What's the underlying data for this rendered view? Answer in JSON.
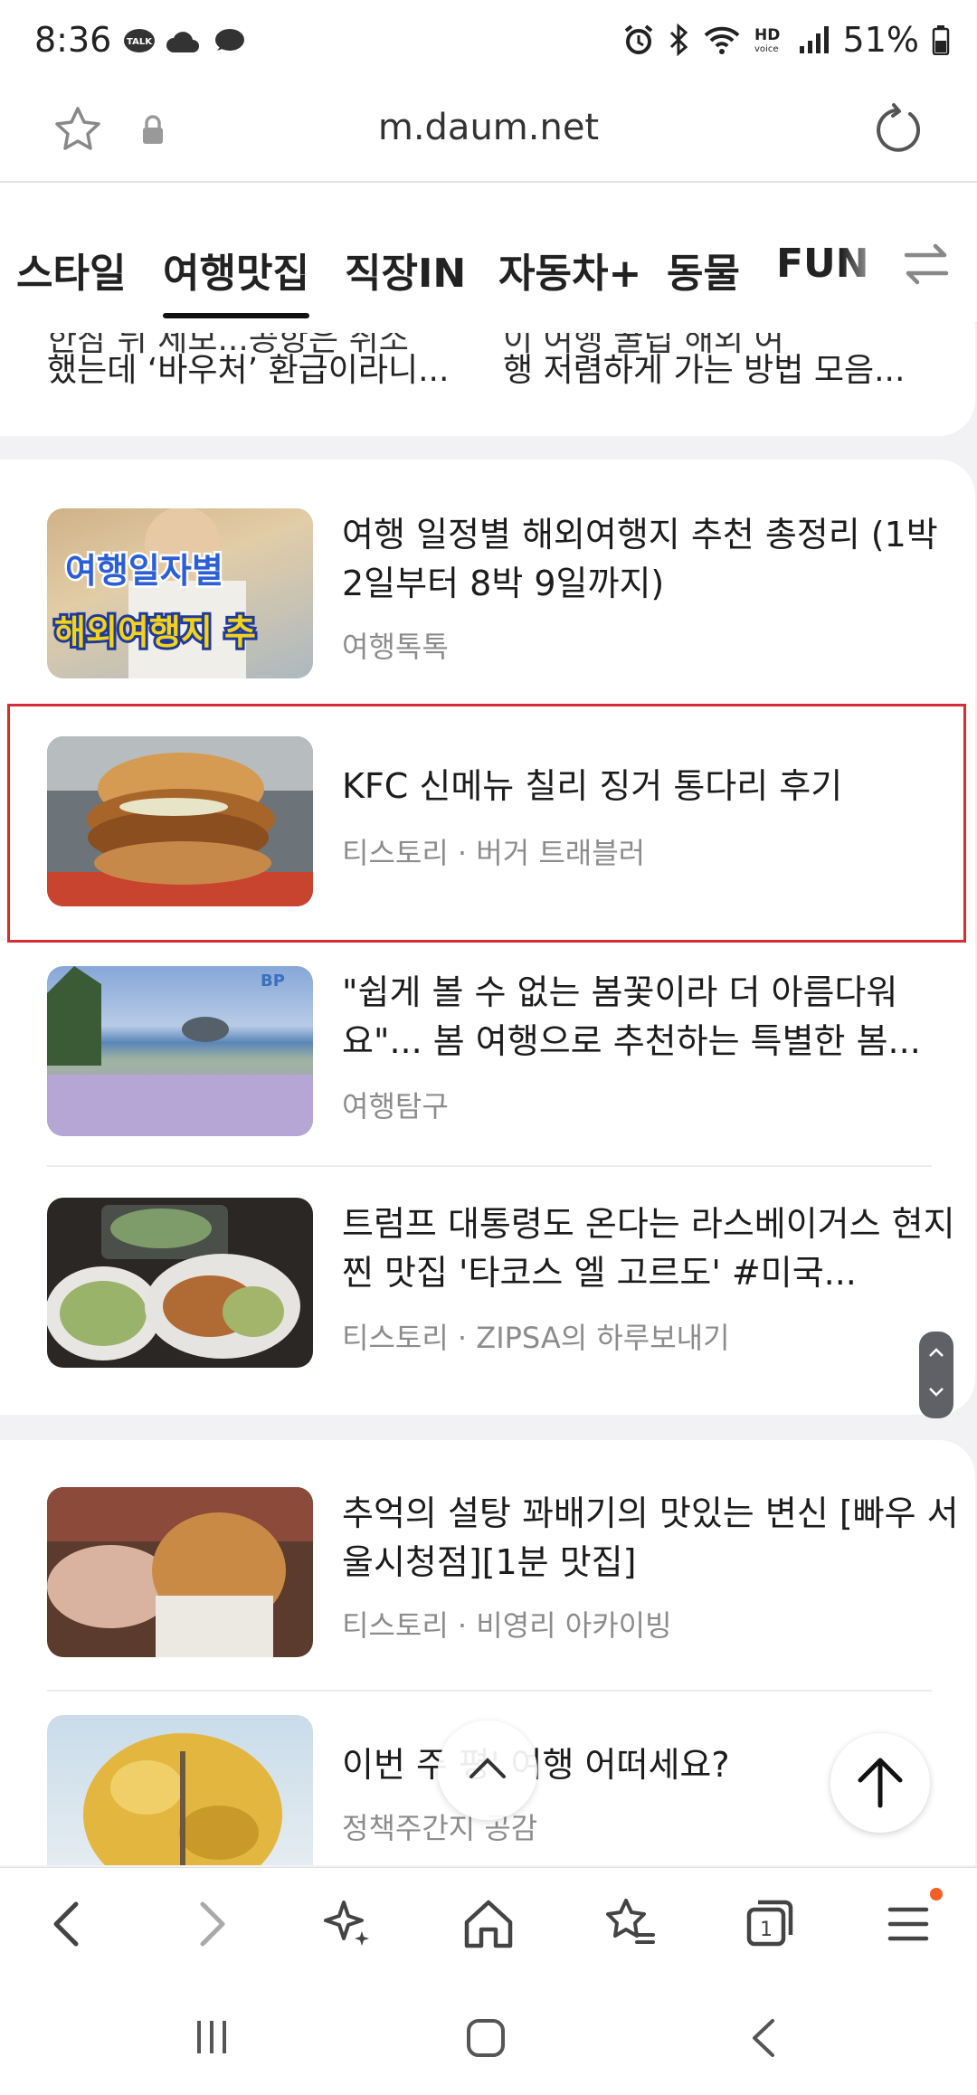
{
  "status_bar": {
    "time": "8:36",
    "left_icons": [
      "talk-icon",
      "cloud-icon",
      "bubble-icon"
    ],
    "right_icons": [
      "alarm-icon",
      "bluetooth-icon",
      "wifi-icon",
      "hd-voice-icon",
      "signal-icon"
    ],
    "battery": "51%"
  },
  "browser": {
    "url": "m.daum.net"
  },
  "tabs": [
    {
      "label": "스타일",
      "active": false
    },
    {
      "label": "여행맛집",
      "active": true
    },
    {
      "label": "직장IN",
      "active": false
    },
    {
      "label": "자동차+",
      "active": false
    },
    {
      "label": "동물",
      "active": false
    },
    {
      "label": "FUN",
      "active": false
    }
  ],
  "partial_card": {
    "left_line1": "한참 뒤 제보...공항은 취소",
    "left_line2": "했는데 ‘바우처’ 환급이라니...",
    "right_line1": "이 여행 꿀팁 해외 여",
    "right_line2": "행 저렴하게 가는 방법 모음..."
  },
  "articles": [
    {
      "title": "여행 일정별 해외여행지 추천 총정리 (1박 2일부터 8박 9일까지)",
      "source": "여행톡톡",
      "thumb_text_1": "여행일자별",
      "thumb_text_2": "해외여행지 추"
    },
    {
      "title": "KFC 신메뉴 칠리 징거 통다리 후기",
      "source": "티스토리 · 버거 트래블러"
    },
    {
      "title": "\"쉽게 볼 수 없는 봄꽃이라 더 아름다워요\"... 봄 여행으로 추천하는 특별한 봄...",
      "source": "여행탐구",
      "thumb_badge": "BP"
    },
    {
      "title": "트럼프 대통령도 온다는 라스베이거스 현지 찐 맛집 '타코스 엘 고르도' #미국...",
      "source": "티스토리 · ZIPSA의 하루보내기"
    },
    {
      "title": "추억의 설탕 꽈배기의 맛있는 변신 [빠우 서울시청점][1분 맛집]",
      "source": "티스토리 · 비영리 아카이빙"
    },
    {
      "title": "이번 주          평' 여행 어떠세요?",
      "source": "정책주간지 공감"
    }
  ],
  "colors": {
    "highlight": "#d92a35",
    "notification_dot": "#f35f26"
  }
}
